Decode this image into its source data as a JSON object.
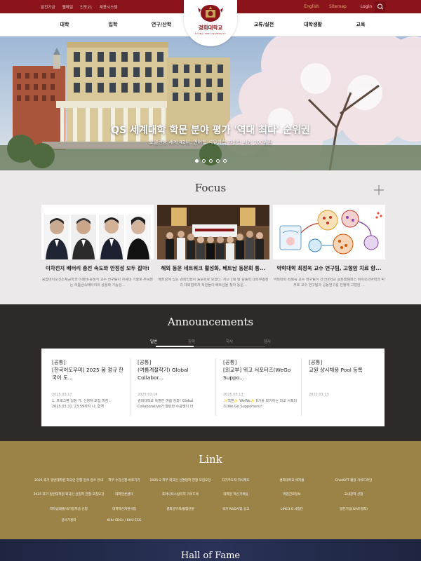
{
  "utility": {
    "left_links": [
      "발전기금",
      "웹메일",
      "인포21",
      "채용시스템"
    ],
    "english": "English",
    "sitemap": "Sitemap",
    "login": "Login"
  },
  "nav": {
    "items": [
      "대학",
      "입학",
      "연구/산학",
      "교류/실천",
      "대학생활",
      "교육"
    ]
  },
  "logo": {
    "name": "경희대학교",
    "subtitle": "KYUNG HEE UNIVERSITY"
  },
  "hero": {
    "title": "QS 세계대학 학문 분야 평가 '역대 최다' 순위권",
    "subtitle": "호텔관광 세계 42위, 언어학·석유화학·치의학 세계 100위권",
    "slide_count": 5,
    "active_slide": 0
  },
  "focus": {
    "title": "Focus",
    "cards": [
      {
        "title": "이차전지 배터리 충전 속도와 안정성 모두 잡아!",
        "summary": "응합바이오신소재공학과 이정태·윤정식 교수 연구팀이 차세대 기술로 주목받는 리튬금속배터리의 상용화 가능성..."
      },
      {
        "title": "해외 동문 네트워크 활성화, 베트남 동문회 통...",
        "summary": "베트남에 있는 경희인들이 동문회로 모였다. 지난 2월 말 김종혁 대외부총장과 대외협력처 직원들이 베트남을 찾아 동문..."
      },
      {
        "title": "약학대학 최정욱 교수 연구팀, 고형암 치료 향...",
        "summary": "약학대학 최정욱 교수 연구팀이 건국대학교 글로벌캠퍼스 바이오의약학과 박주호 교수 연구팀과 공동연구를 진행해 고형암 ..."
      }
    ]
  },
  "announcements": {
    "title": "Announcements",
    "tabs": [
      "일반",
      "장학",
      "학사",
      "행사"
    ],
    "active_tab": 0,
    "items": [
      {
        "tag": "[공통]",
        "title": "[한국어도우미] 2025 봄 정규 한국어 도...",
        "date": "2025.03.17",
        "body": "1. 프로그램 일정 가. 신청자 모집 마감 : 2025.03.31. 23:59까지 나. 합격"
      },
      {
        "tag": "[공통]",
        "title": "(여름계절학기) Global Collabor...",
        "date": "2025.03.14",
        "body": "경희대학교 특별한 여름 강좌! Global Collaborative가 열린한 수강생이 더"
      },
      {
        "tag": "[공통]",
        "title": "[외교부] 위고 서포터즈(WeGo Suppo...",
        "date": "2025.03.13",
        "body": "✨백엔✨ WeWe✨ 6기를 모이하는 외교 서포터즈(We Go Supporters)!"
      },
      {
        "tag": "[공통]",
        "title": "교원 상시채용 Pool 등록",
        "date": "2022.01.13",
        "body": ""
      }
    ]
  },
  "link": {
    "title": "Link",
    "rows": [
      [
        "2025 후기 일반대학원 외국인 전형 원서 접수 안내",
        "학부 수강신청 바로가기",
        "2025-2 학부 외국인 신편입학 전형 모집요강",
        "자기주도적 학사제도",
        "경희대학교 복지몰",
        "ChatGPT 활용 가이드라인"
      ],
      [
        "2025 후기 일반대학원 외국인 신입학 전형 모집요강",
        "대학언론센터",
        "후마니타스칼리지 가이드북",
        "대학원 혁신기획팀",
        "취업진로정보",
        "교내장학 신청"
      ],
      [
        "학자금대출/국가장학금 신청",
        "대학혁신지원사업",
        "경희공부자/통합인원",
        "국가 R&D사업 공고",
        "LINC3.0 사업단",
        "발전기금(GIVE경희)"
      ],
      [
        "글쓰기센터",
        "KHU SDGs / KHU ESG"
      ]
    ]
  },
  "hall_of_fame": {
    "title": "Hall of Fame"
  },
  "colors": {
    "brand_red": "#8a1419",
    "gold": "#9b8347",
    "dark": "#2f2a2a",
    "focus_bg": "#ebe9e9"
  }
}
